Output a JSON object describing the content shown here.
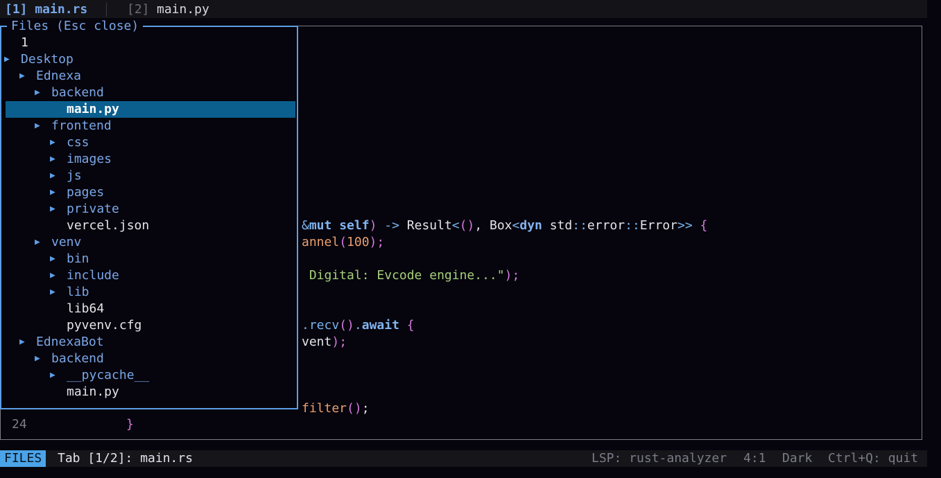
{
  "tabs": [
    {
      "label": "[1] main.rs"
    },
    {
      "num": "[2]",
      "name": "main.py"
    }
  ],
  "files_panel": {
    "title": "Files (Esc close)",
    "rows": [
      {
        "label": "1",
        "type": "file",
        "depth": 0,
        "arrow": false
      },
      {
        "label": "Desktop",
        "type": "dir",
        "depth": 0,
        "arrow": true
      },
      {
        "label": "Ednexa",
        "type": "dir",
        "depth": 1,
        "arrow": true
      },
      {
        "label": "backend",
        "type": "dir",
        "depth": 2,
        "arrow": true
      },
      {
        "label": "main.py",
        "type": "file",
        "depth": 3,
        "arrow": false,
        "selected": true
      },
      {
        "label": "frontend",
        "type": "dir",
        "depth": 2,
        "arrow": true
      },
      {
        "label": "css",
        "type": "dir",
        "depth": 3,
        "arrow": true
      },
      {
        "label": "images",
        "type": "dir",
        "depth": 3,
        "arrow": true
      },
      {
        "label": "js",
        "type": "dir",
        "depth": 3,
        "arrow": true
      },
      {
        "label": "pages",
        "type": "dir",
        "depth": 3,
        "arrow": true
      },
      {
        "label": "private",
        "type": "dir",
        "depth": 3,
        "arrow": true
      },
      {
        "label": "vercel.json",
        "type": "file",
        "depth": 3,
        "arrow": false
      },
      {
        "label": "venv",
        "type": "dir",
        "depth": 2,
        "arrow": true
      },
      {
        "label": "bin",
        "type": "dir",
        "depth": 3,
        "arrow": true
      },
      {
        "label": "include",
        "type": "dir",
        "depth": 3,
        "arrow": true
      },
      {
        "label": "lib",
        "type": "dir",
        "depth": 3,
        "arrow": true
      },
      {
        "label": "lib64",
        "type": "file",
        "depth": 3,
        "arrow": false
      },
      {
        "label": "pyvenv.cfg",
        "type": "file",
        "depth": 3,
        "arrow": false
      },
      {
        "label": "EdnexaBot",
        "type": "dir",
        "depth": 1,
        "arrow": true
      },
      {
        "label": "backend",
        "type": "dir",
        "depth": 2,
        "arrow": true
      },
      {
        "label": "__pycache__",
        "type": "dir",
        "depth": 3,
        "arrow": true
      },
      {
        "label": "main.py",
        "type": "file",
        "depth": 3,
        "arrow": false
      }
    ],
    "arrow_glyph": "▶",
    "arrow_icon": "triangle-right-icon"
  },
  "code": {
    "line1": {
      "t1": "&",
      "t2": "mut",
      "t3": " ",
      "t4": "self",
      "t5": ")",
      "t6": " -> ",
      "t7": "Result",
      "t8": "<",
      "t9": "()",
      "t10": ", Box",
      "t11": "<",
      "t12": "dyn",
      "t13": " std",
      "t14": "::",
      "t15": "error",
      "t16": "::",
      "t17": "Error",
      "t18": ">>",
      "t19": " ",
      "t20": "{"
    },
    "line2": {
      "t1": "annel",
      "t2": "(",
      "t3": "100",
      "t4": ");"
    },
    "line3": {
      "t1": " Digital: Evcode engine...\"",
      "t2": ");"
    },
    "line4": {
      "t1": ".",
      "t2": "recv",
      "t3": "()",
      "t4": ".",
      "t5": "await",
      "t6": " ",
      "t7": "{"
    },
    "line5": {
      "t1": "vent",
      "t2": ");"
    },
    "line6": {
      "t1": "filter",
      "t2": "()",
      "t3": ";"
    },
    "gutter_line": "24",
    "gutter_brace": "}"
  },
  "status": {
    "mode": "FILES",
    "tab_info": "Tab [1/2]: main.rs",
    "lsp": "LSP: rust-analyzer",
    "position": "4:1",
    "theme": "Dark",
    "quit_hint": "Ctrl+Q: quit"
  }
}
